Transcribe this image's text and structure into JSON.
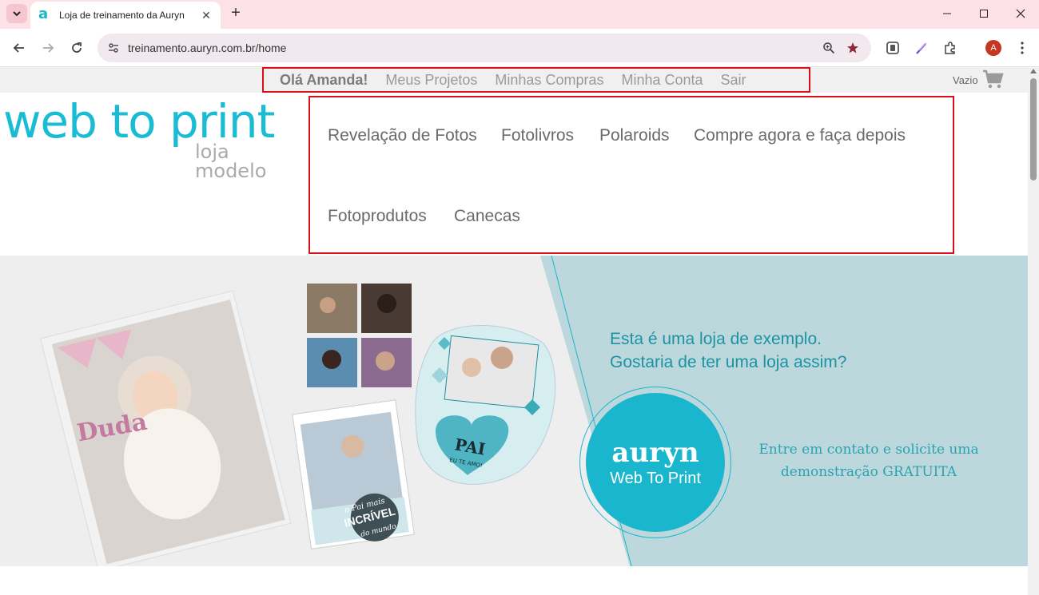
{
  "browser": {
    "tab_title": "Loja de treinamento da Auryn",
    "url": "treinamento.auryn.com.br/home",
    "profile_initial": "A"
  },
  "page": {
    "usernav": {
      "greeting": "Olá Amanda!",
      "links": [
        "Meus Projetos",
        "Minhas Compras",
        "Minha Conta",
        "Sair"
      ]
    },
    "cart": {
      "label": "Vazio"
    },
    "logo": {
      "main": "web to print",
      "sub": "loja modelo"
    },
    "mainnav": {
      "items": [
        "Revelação de Fotos",
        "Fotolivros",
        "Polaroids",
        "Compre agora e faça depois",
        "Fotoprodutos",
        "Canecas"
      ]
    },
    "banner": {
      "headline_line1": "Esta é uma loja de exemplo.",
      "headline_line2": "Gostaria de ter uma loja assim?",
      "badge_name": "auryn",
      "badge_tag": "Web To Print",
      "cta_line1": "Entre em contato e solicite uma",
      "cta_line2": "demonstração GRATUITA",
      "photobook_name": "Duda",
      "magnet_text": "PAI",
      "magnet_sub": "EU TE AMO!",
      "calendar_text": "o Pai mais",
      "calendar_big": "INCRÍVEL",
      "calendar_end": "do mundo"
    }
  },
  "colors": {
    "accent": "#19bcd3",
    "highlight_border": "#d9101a",
    "banner_teal": "#bcd8dc"
  }
}
